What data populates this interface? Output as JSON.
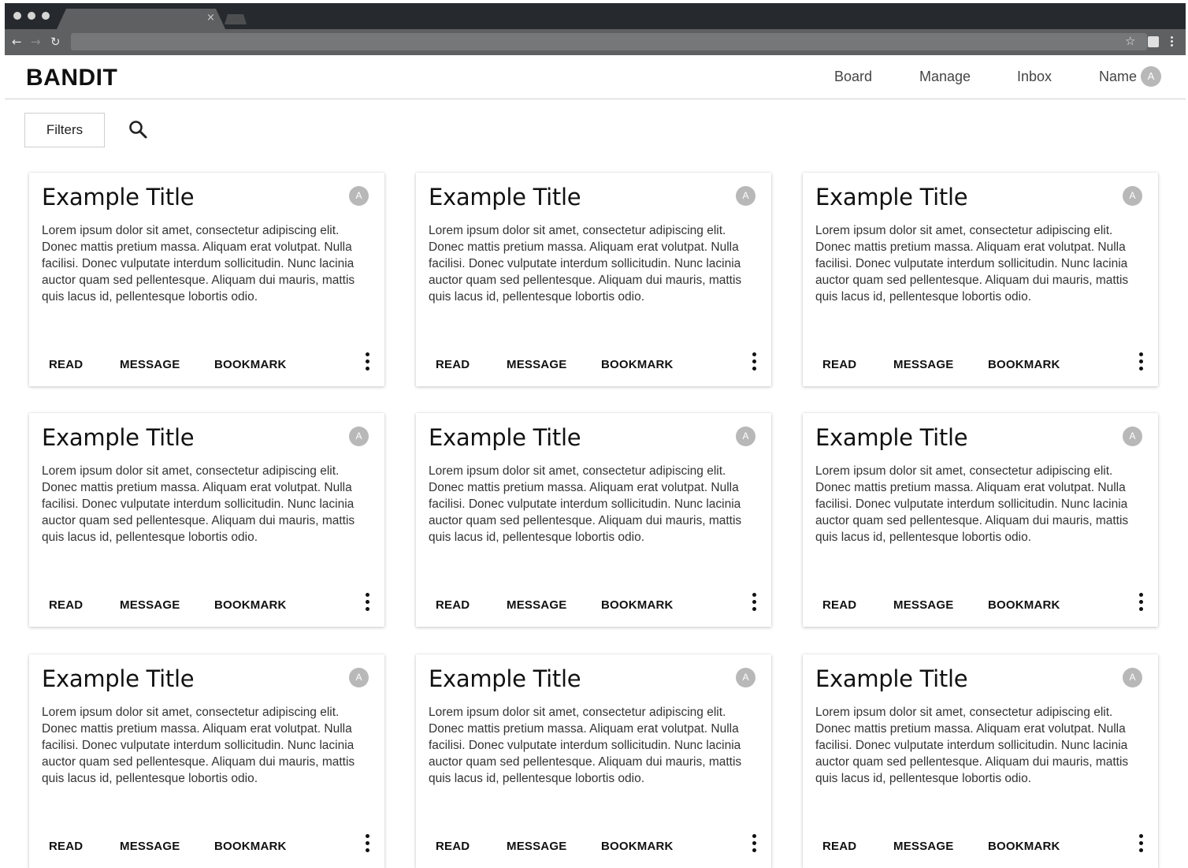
{
  "browser": {
    "tab_close": "×",
    "back_icon": "←",
    "forward_icon": "→",
    "reload_icon": "↻",
    "star_icon": "☆"
  },
  "header": {
    "logo": "BANDIT",
    "nav": [
      {
        "label": "Board"
      },
      {
        "label": "Manage"
      },
      {
        "label": "Inbox"
      },
      {
        "label": "Name"
      }
    ],
    "avatar_initial": "A"
  },
  "toolbar": {
    "filters_label": "Filters",
    "search_icon": "search-icon"
  },
  "cards": [
    {
      "title": "Example Title",
      "avatar": "A",
      "body": "Lorem ipsum dolor sit amet, consectetur adipiscing elit. Donec mattis pretium massa. Aliquam erat volutpat. Nulla facilisi. Donec vulputate interdum sollicitudin. Nunc lacinia auctor quam sed pellentesque. Aliquam dui mauris, mattis quis lacus id, pellentesque lobortis odio.",
      "actions": [
        "READ",
        "MESSAGE",
        "BOOKMARK"
      ]
    },
    {
      "title": "Example Title",
      "avatar": "A",
      "body": "Lorem ipsum dolor sit amet, consectetur adipiscing elit. Donec mattis pretium massa. Aliquam erat volutpat. Nulla facilisi. Donec vulputate interdum sollicitudin. Nunc lacinia auctor quam sed pellentesque. Aliquam dui mauris, mattis quis lacus id, pellentesque lobortis odio.",
      "actions": [
        "READ",
        "MESSAGE",
        "BOOKMARK"
      ]
    },
    {
      "title": "Example Title",
      "avatar": "A",
      "body": "Lorem ipsum dolor sit amet, consectetur adipiscing elit. Donec mattis pretium massa. Aliquam erat volutpat. Nulla facilisi. Donec vulputate interdum sollicitudin. Nunc lacinia auctor quam sed pellentesque. Aliquam dui mauris, mattis quis lacus id, pellentesque lobortis odio.",
      "actions": [
        "READ",
        "MESSAGE",
        "BOOKMARK"
      ]
    },
    {
      "title": "Example Title",
      "avatar": "A",
      "body": "Lorem ipsum dolor sit amet, consectetur adipiscing elit. Donec mattis pretium massa. Aliquam erat volutpat. Nulla facilisi. Donec vulputate interdum sollicitudin. Nunc lacinia auctor quam sed pellentesque. Aliquam dui mauris, mattis quis lacus id, pellentesque lobortis odio.",
      "actions": [
        "READ",
        "MESSAGE",
        "BOOKMARK"
      ]
    },
    {
      "title": "Example Title",
      "avatar": "A",
      "body": "Lorem ipsum dolor sit amet, consectetur adipiscing elit. Donec mattis pretium massa. Aliquam erat volutpat. Nulla facilisi. Donec vulputate interdum sollicitudin. Nunc lacinia auctor quam sed pellentesque. Aliquam dui mauris, mattis quis lacus id, pellentesque lobortis odio.",
      "actions": [
        "READ",
        "MESSAGE",
        "BOOKMARK"
      ]
    },
    {
      "title": "Example Title",
      "avatar": "A",
      "body": "Lorem ipsum dolor sit amet, consectetur adipiscing elit. Donec mattis pretium massa. Aliquam erat volutpat. Nulla facilisi. Donec vulputate interdum sollicitudin. Nunc lacinia auctor quam sed pellentesque. Aliquam dui mauris, mattis quis lacus id, pellentesque lobortis odio.",
      "actions": [
        "READ",
        "MESSAGE",
        "BOOKMARK"
      ]
    },
    {
      "title": "Example Title",
      "avatar": "A",
      "body": "Lorem ipsum dolor sit amet, consectetur adipiscing elit. Donec mattis pretium massa. Aliquam erat volutpat. Nulla facilisi. Donec vulputate interdum sollicitudin. Nunc lacinia auctor quam sed pellentesque. Aliquam dui mauris, mattis quis lacus id, pellentesque lobortis odio.",
      "actions": [
        "READ",
        "MESSAGE",
        "BOOKMARK"
      ]
    },
    {
      "title": "Example Title",
      "avatar": "A",
      "body": "Lorem ipsum dolor sit amet, consectetur adipiscing elit. Donec mattis pretium massa. Aliquam erat volutpat. Nulla facilisi. Donec vulputate interdum sollicitudin. Nunc lacinia auctor quam sed pellentesque. Aliquam dui mauris, mattis quis lacus id, pellentesque lobortis odio.",
      "actions": [
        "READ",
        "MESSAGE",
        "BOOKMARK"
      ]
    },
    {
      "title": "Example Title",
      "avatar": "A",
      "body": "Lorem ipsum dolor sit amet, consectetur adipiscing elit. Donec mattis pretium massa. Aliquam erat volutpat. Nulla facilisi. Donec vulputate interdum sollicitudin. Nunc lacinia auctor quam sed pellentesque. Aliquam dui mauris, mattis quis lacus id, pellentesque lobortis odio.",
      "actions": [
        "READ",
        "MESSAGE",
        "BOOKMARK"
      ]
    }
  ]
}
